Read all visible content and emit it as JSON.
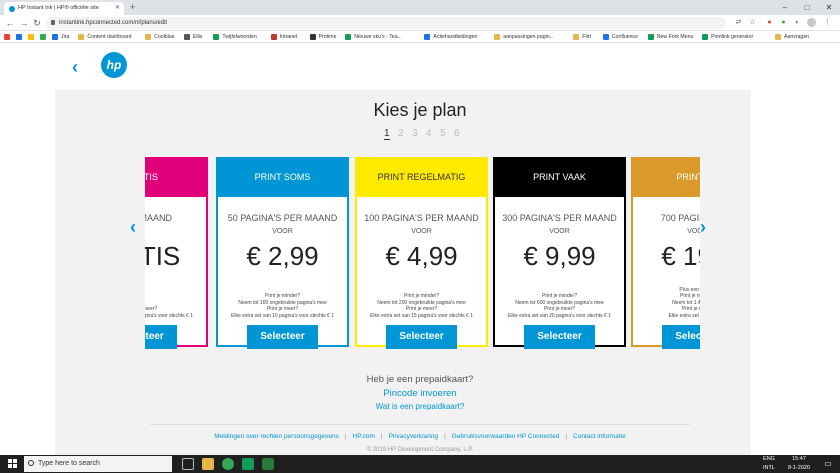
{
  "browser": {
    "tab_title": "HP Instant Ink | HP® officiële site",
    "url": "instantink.hpconnected.com/nl/plans/edit",
    "bookmarks": [
      {
        "label": "",
        "color": "#ea4335"
      },
      {
        "label": "",
        "color": "#1a73e8"
      },
      {
        "label": "",
        "color": "#fbbc04"
      },
      {
        "label": "",
        "color": "#34a853"
      },
      {
        "label": "Jira",
        "color": "#1a73e8"
      },
      {
        "label": "Content dashboard",
        "color": "#e6b84c"
      },
      {
        "label": "Coolblue",
        "color": "#e6b84c"
      },
      {
        "label": "Ellis",
        "color": "#555555"
      },
      {
        "label": "Twijfelwoorden",
        "color": "#0f9d58"
      },
      {
        "label": "Intranet",
        "color": "#c0392b"
      },
      {
        "label": "Protime",
        "color": "#333333"
      },
      {
        "label": "Nieuwe sku's - Tea...",
        "color": "#0f9d58"
      },
      {
        "label": "Actiehandleidingen",
        "color": "#1a73e8"
      },
      {
        "label": "aanpassingen pagin...",
        "color": "#e6b84c"
      },
      {
        "label": "Flirt",
        "color": "#e6b84c"
      },
      {
        "label": "Confluence",
        "color": "#1a73e8"
      },
      {
        "label": "New Fork Menu",
        "color": "#0f9d58"
      },
      {
        "label": "Printlink generator",
        "color": "#0f9d58"
      },
      {
        "label": "Aanvragen",
        "color": "#e6b84c"
      }
    ]
  },
  "page": {
    "title": "Kies je plan",
    "pages": [
      "1",
      "2",
      "3",
      "4",
      "5",
      "6"
    ],
    "active_page": "1"
  },
  "plans": [
    {
      "name": "GRATIS",
      "color": "#e2007a",
      "text_color": "#ffffff",
      "pages": "...PER MAAND",
      "voor": "",
      "price": "...ATIS",
      "notes": [
        "Print je meer?",
        "Elke extra set van 10 pagina's voor slechts € 1"
      ]
    },
    {
      "name": "PRINT SOMS",
      "color": "#0096d6",
      "text_color": "#ffffff",
      "pages": "50 PAGINA'S PER MAAND",
      "voor": "VOOR",
      "price": "€ 2,99",
      "notes": [
        "Print je minder?",
        "Neem tot 100 ongebruikte pagina's mee",
        "Print je meer?",
        "Elke extra set van 10 pagina's voor slechts € 1"
      ]
    },
    {
      "name": "PRINT REGELMATIG",
      "color": "#ffea00",
      "text_color": "#333333",
      "pages": "100 PAGINA'S PER MAAND",
      "voor": "VOOR",
      "price": "€ 4,99",
      "notes": [
        "Print je minder?",
        "Neem tot 200 ongebruikte pagina's mee",
        "Print je meer?",
        "Elke extra set van 15 pagina's voor slechts € 1"
      ]
    },
    {
      "name": "PRINT VAAK",
      "color": "#000000",
      "text_color": "#ffffff",
      "pages": "300 PAGINA'S PER MAAND",
      "voor": "VOOR",
      "price": "€ 9,99",
      "notes": [
        "Print je minder?",
        "Neem tot 600 ongebruikte pagina's mee",
        "Print je meer?",
        "Elke extra set van 20 pagina's voor slechts € 1"
      ]
    },
    {
      "name": "PRINT Z...",
      "color": "#d99a2b",
      "text_color": "#ffffff",
      "pages": "700 PAGINA'S P...",
      "voor": "VOOR",
      "price": "€ 19...",
      "notes": [
        "Plus een extra...",
        "Print je minder?",
        "Neem tot 1.400 onge...",
        "Print je meer?",
        "Elke extra set van 20 pa..."
      ]
    }
  ],
  "select_label": "Selecteer",
  "prepaid": {
    "question": "Heb je een prepaidkaart?",
    "pincode_link": "Pincode invoeren",
    "what_link": "Wat is een prepaidkaart?"
  },
  "footer": {
    "links": [
      "Meldingen over rechten persoonsgegevens",
      "HP.com",
      "Privacyverklaring",
      "Gebruiksvoorwaarden HP Connected",
      "Contact informatie"
    ],
    "copyright": "© 2019 HP Development Company, L.P."
  },
  "taskbar": {
    "search_placeholder": "Type here to search",
    "lang": "ENG",
    "lang2": "INTL",
    "time": "15:47",
    "date": "8-1-2020"
  }
}
